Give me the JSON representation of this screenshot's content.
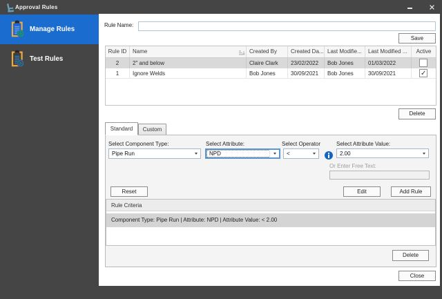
{
  "colors": {
    "accent": "#1a6ccf",
    "frame": "#454545",
    "selected_row": "#d9d9d9",
    "focus_border": "#5a96d2",
    "info_blue": "#1464c4",
    "clipboard_orange": "#efa93f",
    "badge_green": "#1e9e4e",
    "badge_blue": "#2574ac",
    "logo_teal": "#67a0b5"
  },
  "titlebar": {
    "title": "Approval Rules",
    "logo_icon": "app-logo-icon",
    "minimize_icon": "minimize-icon",
    "close_icon": "close-icon"
  },
  "sidebar": {
    "items": [
      {
        "label": "Manage Rules"
      },
      {
        "label": "Test Rules"
      }
    ]
  },
  "main": {
    "rule_name_label": "Rule Name:",
    "rule_name_value": "",
    "save_label": "Save",
    "grid": {
      "sort_column": "Name",
      "columns": [
        "Rule ID",
        "Name",
        "Created By",
        "Created Da...",
        "Last Modifie...",
        "Last Modified ...",
        "Active"
      ],
      "rows": [
        {
          "rule_id": "2",
          "name": "2\" and below",
          "created_by": "Claire Clark",
          "created_date": "23/02/2022",
          "last_modified_by": "Bob Jones",
          "last_modified_date": "01/03/2022",
          "active": false
        },
        {
          "rule_id": "1",
          "name": "Ignore Welds",
          "created_by": "Bob Jones",
          "created_date": "30/09/2021",
          "last_modified_by": "Bob Jones",
          "last_modified_date": "30/09/2021",
          "active": true
        }
      ]
    },
    "delete_rule_label": "Delete",
    "tabs": [
      {
        "label": "Standard"
      },
      {
        "label": "Custom"
      }
    ],
    "standard_tab": {
      "component_type_label": "Select Component Type:",
      "component_type_value": "Pipe Run",
      "attribute_label": "Select Attribute:",
      "attribute_value": "NPD",
      "operator_label": "Select Operator",
      "operator_value": "<",
      "attribute_value_label": "Select Attribute Value:",
      "attribute_value_value": "2.00",
      "free_text_label": "Or Enter Free Text:",
      "free_text_value": "",
      "reset_label": "Reset",
      "edit_label": "Edit",
      "add_rule_label": "Add Rule",
      "criteria_group_title": "Rule Criteria",
      "criteria_items": [
        "Component Type: Pipe Run | Attribute: NPD | Attribute Value: < 2.00"
      ],
      "delete_criteria_label": "Delete"
    },
    "close_label": "Close",
    "checkmark": "✓"
  }
}
